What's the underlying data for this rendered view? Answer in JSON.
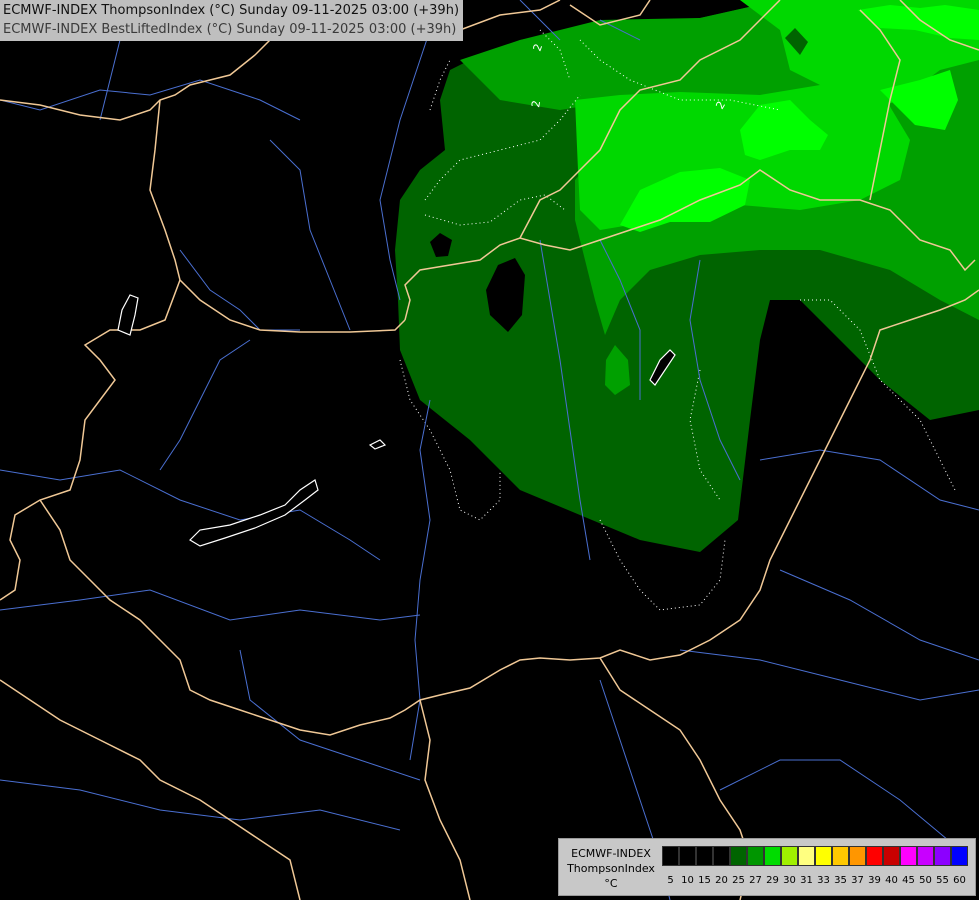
{
  "title": {
    "line1": "ECMWF-INDEX ThompsonIndex (°C) Sunday 09-11-2025 03:00 (+39h)",
    "line2": "ECMWF-INDEX BestLiftedIndex (°C) Sunday 09-11-2025 03:00 (+39h)"
  },
  "contour_labels": [
    "2",
    "2",
    "2"
  ],
  "legend": {
    "line1": "ECMWF-INDEX",
    "line2": "ThompsonIndex",
    "line3": "°C",
    "levels": [
      {
        "label": "5",
        "color": "#000000"
      },
      {
        "label": "10",
        "color": "#000000"
      },
      {
        "label": "15",
        "color": "#000000"
      },
      {
        "label": "20",
        "color": "#000000"
      },
      {
        "label": "25",
        "color": "#006400"
      },
      {
        "label": "27",
        "color": "#009600"
      },
      {
        "label": "29",
        "color": "#00dc00"
      },
      {
        "label": "30",
        "color": "#a0f000"
      },
      {
        "label": "31",
        "color": "#ffff80"
      },
      {
        "label": "33",
        "color": "#ffff00"
      },
      {
        "label": "35",
        "color": "#ffc800"
      },
      {
        "label": "37",
        "color": "#ff9600"
      },
      {
        "label": "39",
        "color": "#ff0000"
      },
      {
        "label": "40",
        "color": "#c80000"
      },
      {
        "label": "45",
        "color": "#ff00ff"
      },
      {
        "label": "50",
        "color": "#c800ff"
      },
      {
        "label": "55",
        "color": "#8c00ff"
      },
      {
        "label": "60",
        "color": "#0000ff"
      }
    ]
  },
  "colors": {
    "background": "#000000",
    "dark_green": "#006400",
    "medium_green": "#008c00",
    "bright_green": "#00dc00",
    "light_green": "#00ff00",
    "border": "#f0c896",
    "river": "#4a6fd1",
    "lake_outline": "#ffffff"
  }
}
